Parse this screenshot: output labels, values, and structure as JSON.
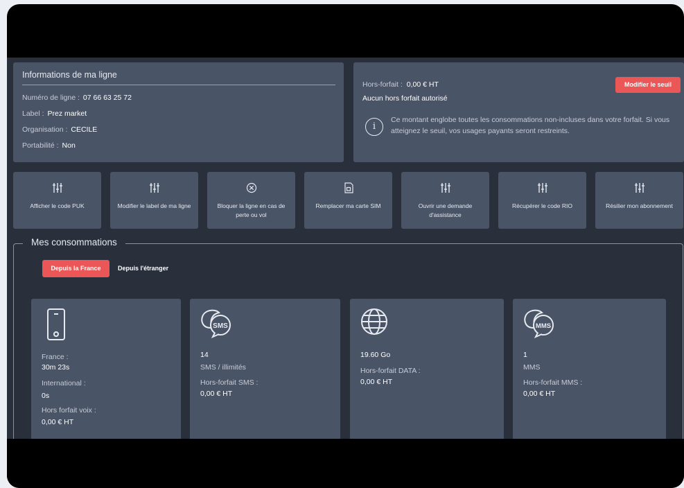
{
  "info": {
    "title": "Informations de ma ligne",
    "rows": [
      {
        "label": "Numéro de ligne :",
        "value": "07 66 63 25 72"
      },
      {
        "label": "Label :",
        "value": "Prez market"
      },
      {
        "label": "Organisation :",
        "value": "CECILE"
      },
      {
        "label": "Portabilité :",
        "value": "Non"
      }
    ]
  },
  "hors_forfait": {
    "label": "Hors-forfait :",
    "value": "0,00 € HT",
    "status": "Aucun hors forfait autorisé",
    "button": "Modifier le seuil",
    "description": "Ce montant englobe toutes les consommations non-incluses dans votre forfait. Si vous atteignez le seuil, vos usages payants seront restreints.",
    "info_icon": "info-circle-icon"
  },
  "actions": [
    {
      "label": "Afficher le code PUK",
      "icon": "sliders-icon"
    },
    {
      "label": "Modifier le label de ma ligne",
      "icon": "sliders-icon"
    },
    {
      "label": "Bloquer la ligne en cas de perte ou vol",
      "icon": "block-icon"
    },
    {
      "label": "Remplacer ma carte SIM",
      "icon": "sim-card-icon"
    },
    {
      "label": "Ouvrir une demande d'assistance",
      "icon": "sliders-icon"
    },
    {
      "label": "Récupérer le code RIO",
      "icon": "sliders-icon"
    },
    {
      "label": "Résilier mon abonnement",
      "icon": "sliders-icon"
    }
  ],
  "consommations": {
    "title": "Mes consommations",
    "tabs": [
      "Depuis la France",
      "Depuis l'étranger"
    ],
    "active_tab": "Depuis la France",
    "cards": {
      "voice": {
        "icon": "phone-icon",
        "france_label": "France :",
        "france_value": "30m 23s",
        "intl_label": "International :",
        "intl_value": "0s",
        "hf_label": "Hors forfait voix :",
        "hf_value": "0,00 € HT"
      },
      "sms": {
        "icon": "sms-bubble-icon",
        "icon_text": "SMS",
        "count": "14",
        "unit": "SMS / illimités",
        "hf_label": "Hors-forfait SMS :",
        "hf_value": "0,00 € HT"
      },
      "data": {
        "icon": "globe-icon",
        "amount": "19.60 Go",
        "hf_label": "Hors-forfait DATA :",
        "hf_value": "0,00 € HT"
      },
      "mms": {
        "icon": "mms-bubble-icon",
        "icon_text": "MMS",
        "count": "1",
        "unit": "MMS",
        "hf_label": "Hors-forfait MMS :",
        "hf_value": "0,00 € HT"
      }
    }
  },
  "colors": {
    "background": "#2a303b",
    "panel": "#4a5467",
    "accent": "#eb5757",
    "frame": "#000000"
  }
}
